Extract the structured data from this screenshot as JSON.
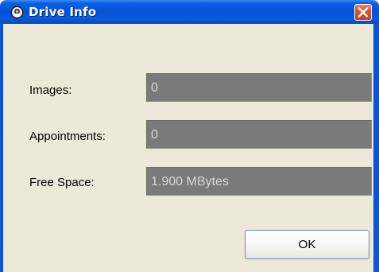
{
  "window": {
    "title": "Drive Info",
    "icon": "app-icon",
    "close_icon": "close-icon"
  },
  "fields": [
    {
      "label": "Images:",
      "value": "0"
    },
    {
      "label": "Appointments:",
      "value": "0"
    },
    {
      "label": "Free Space:",
      "value": "1.900 MBytes"
    }
  ],
  "buttons": {
    "ok_label": "OK"
  },
  "colors": {
    "titlebar_blue": "#0553d6",
    "client_background": "#ece9d8",
    "field_background": "#7a7a7a",
    "close_button_red": "#d9532f"
  }
}
